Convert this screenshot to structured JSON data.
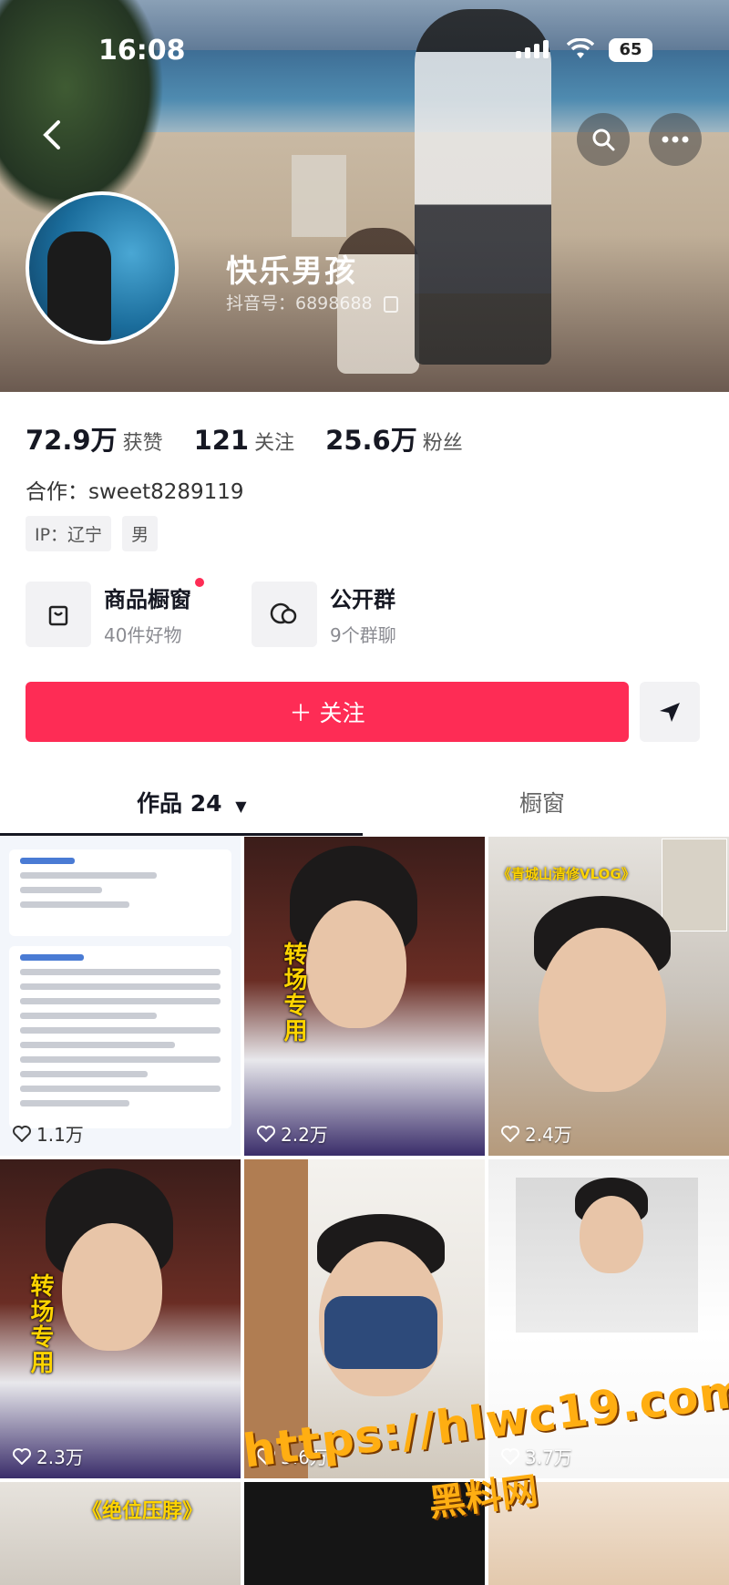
{
  "status_bar": {
    "time": "16:08",
    "battery": "65"
  },
  "profile": {
    "name": "快乐男孩",
    "douyin_id": "抖音号：6898688"
  },
  "stats": [
    {
      "value": "72.9万",
      "label": "获赞"
    },
    {
      "value": "121",
      "label": "关注"
    },
    {
      "value": "25.6万",
      "label": "粉丝"
    }
  ],
  "cooperation": "合作：sweet8289119",
  "tags": [
    "IP：辽宁",
    "男"
  ],
  "entries": [
    {
      "title": "商品橱窗",
      "subtitle": "40件好物",
      "icon": "shopping-bag-icon"
    },
    {
      "title": "公开群",
      "subtitle": "9个群聊",
      "icon": "group-chat-icon"
    }
  ],
  "follow_button": "＋ 关注",
  "tabs": {
    "works": "作品 24",
    "window": "橱窗"
  },
  "videos": [
    {
      "likes": "1.1万",
      "kind": "document"
    },
    {
      "likes": "2.2万",
      "overlay": "转场专用"
    },
    {
      "likes": "2.4万",
      "overlay": "《青城山清修VLOG》"
    },
    {
      "likes": "2.3万",
      "overlay": "转场专用"
    },
    {
      "likes": "3.6万",
      "overlay": ""
    },
    {
      "likes": "3.7万",
      "overlay": ""
    },
    {
      "likes": "",
      "overlay": "《绝位压脖》"
    }
  ],
  "watermark": {
    "url": "https://hlwc19.com",
    "name": "黑料网"
  },
  "colors": {
    "accent": "#fe2c55",
    "text": "#161823",
    "muted": "#8a8b91"
  }
}
